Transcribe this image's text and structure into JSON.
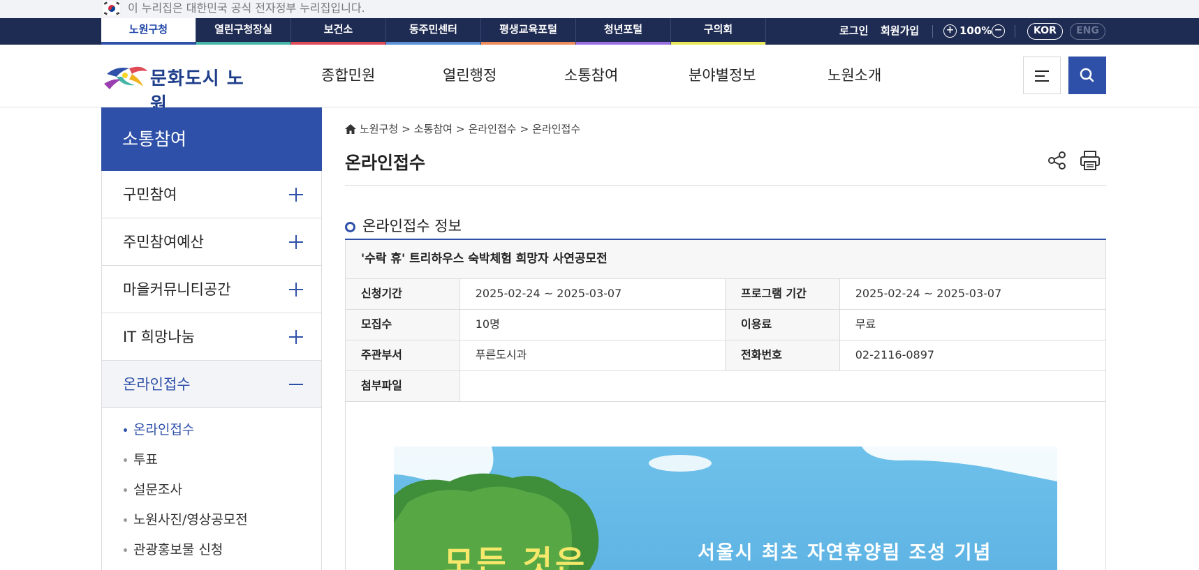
{
  "gov_banner": {
    "text": "이 누리집은 대한민국 공식 전자정부 누리집입니다."
  },
  "site_tabs": [
    {
      "label": "노원구청",
      "color": "#2e50a8"
    },
    {
      "label": "열린구청장실",
      "color": "#45b5a7"
    },
    {
      "label": "보건소",
      "color": "#e04b57"
    },
    {
      "label": "동주민센터",
      "color": "#5b8fd6"
    },
    {
      "label": "평생교육포털",
      "color": "#ee8b5c"
    },
    {
      "label": "청년포털",
      "color": "#9a6fe0"
    },
    {
      "label": "구의회",
      "color": "#e8e85a"
    }
  ],
  "top_right": {
    "login": "로그인",
    "signup": "회원가입",
    "zoom_in": "+",
    "zoom_level": "100%",
    "zoom_out": "−",
    "lang_kor": "KOR",
    "lang_eng": "ENG"
  },
  "header": {
    "logo_text": "문화도시 노원",
    "gnb": [
      "종합민원",
      "열린행정",
      "소통참여",
      "분야별정보",
      "노원소개"
    ]
  },
  "sidebar": {
    "title": "소통참여",
    "items": [
      {
        "label": "구민참여"
      },
      {
        "label": "주민참여예산"
      },
      {
        "label": "마을커뮤니티공간"
      },
      {
        "label": "IT 희망나눔"
      },
      {
        "label": "온라인접수"
      }
    ],
    "sub_items": [
      "온라인접수",
      "투표",
      "설문조사",
      "노원사진/영상공모전",
      "관광홍보물 신청"
    ]
  },
  "breadcrumb": {
    "items": [
      "노원구청",
      "소통참여",
      "온라인접수",
      "온라인접수"
    ],
    "separator": ">"
  },
  "page": {
    "title": "온라인접수",
    "section_title": "온라인접수 정보"
  },
  "info": {
    "program_name": "'수락 휴' 트리하우스 숙박체험 희망자 사연공모전",
    "apply_period_label": "신청기간",
    "apply_period": "2025-02-24 ~ 2025-03-07",
    "program_period_label": "프로그램 기간",
    "program_period": "2025-02-24 ~ 2025-03-07",
    "recruit_label": "모집수",
    "recruit": "10명",
    "fee_label": "이용료",
    "fee": "무료",
    "dept_label": "주관부서",
    "dept": "푸른도시과",
    "phone_label": "전화번호",
    "phone": "02-2116-0897",
    "attach_label": "첨부파일",
    "attach": ""
  },
  "poster": {
    "caption": "서울시 최초 자연휴양림 조성 기념",
    "headline": "모든 것은"
  }
}
